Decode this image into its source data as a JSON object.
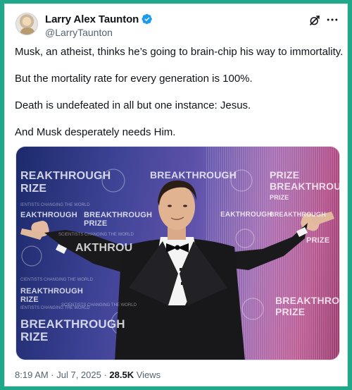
{
  "tweet": {
    "display_name": "Larry Alex Taunton",
    "handle": "@LarryTaunton",
    "lines": [
      "Musk, an atheist, thinks he’s going to brain-chip his way to immortality.",
      "But the mortality rate for every generation is 100%.",
      "Death is undefeated in all but one instance: Jesus.",
      "And Musk desperately needs Him."
    ],
    "timestamp": "8:19 AM · Jul 7, 2025 · ",
    "views_count": "28.5K",
    "views_label": " Views"
  },
  "icons": {
    "verified": "verified-badge-icon",
    "grok": "grok-icon",
    "more": "more-options-icon"
  },
  "backdrop": {
    "brand_words": [
      "REAKTHROUGH",
      "RIZE",
      "BREAKTHROUGH",
      "PRIZE",
      "BREAKTHROUGH",
      "PRIZE",
      "EAKTHROUGH",
      "BREAKTHROUGH",
      "PRIZE",
      "AKTHROU",
      "REAKTHROUGH",
      "RIZE",
      "BREAKTHROUGH",
      "RIZE",
      "BREAKTHROUGH",
      "PRIZE",
      "EAKTHROUGH",
      "BREAKTHROUGH",
      "PRIZE"
    ],
    "taglines": [
      "IENTISTS CHANGING THE WORLD",
      "SCIENTISTS CHANGING THE WORLD",
      "CIENTISTS CHANGING THE WORLD",
      "IENTISTS CHANGING THE WORLD",
      "SCIENTISTS CHANGING THE WORLD"
    ]
  },
  "colors": {
    "frame": "#1fa889",
    "verified": "#1d9bf0",
    "muted_text": "#536471"
  }
}
